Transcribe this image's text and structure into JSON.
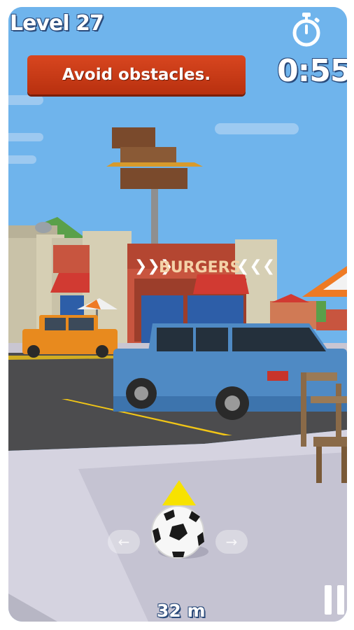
{
  "hud": {
    "level_label": "Level 27",
    "timer_value": "0:55",
    "objective": "Avoid obstacles.",
    "distance": "32 m"
  },
  "scene": {
    "shop_sign": "BURGERS",
    "sign_arrows_left": "❯❯❯",
    "sign_arrows_right": "❮❮❮"
  },
  "controls": {
    "steer_left_icon": "arrow-left-icon",
    "steer_right_icon": "arrow-right-icon",
    "pause_icon": "pause-icon",
    "timer_icon": "stopwatch-icon"
  },
  "colors": {
    "banner": "#c63a17",
    "sky": "#6fb4ec",
    "ball_arrow": "#f7e200",
    "blue_car": "#4f8ac4",
    "orange_car": "#e88a1e"
  }
}
